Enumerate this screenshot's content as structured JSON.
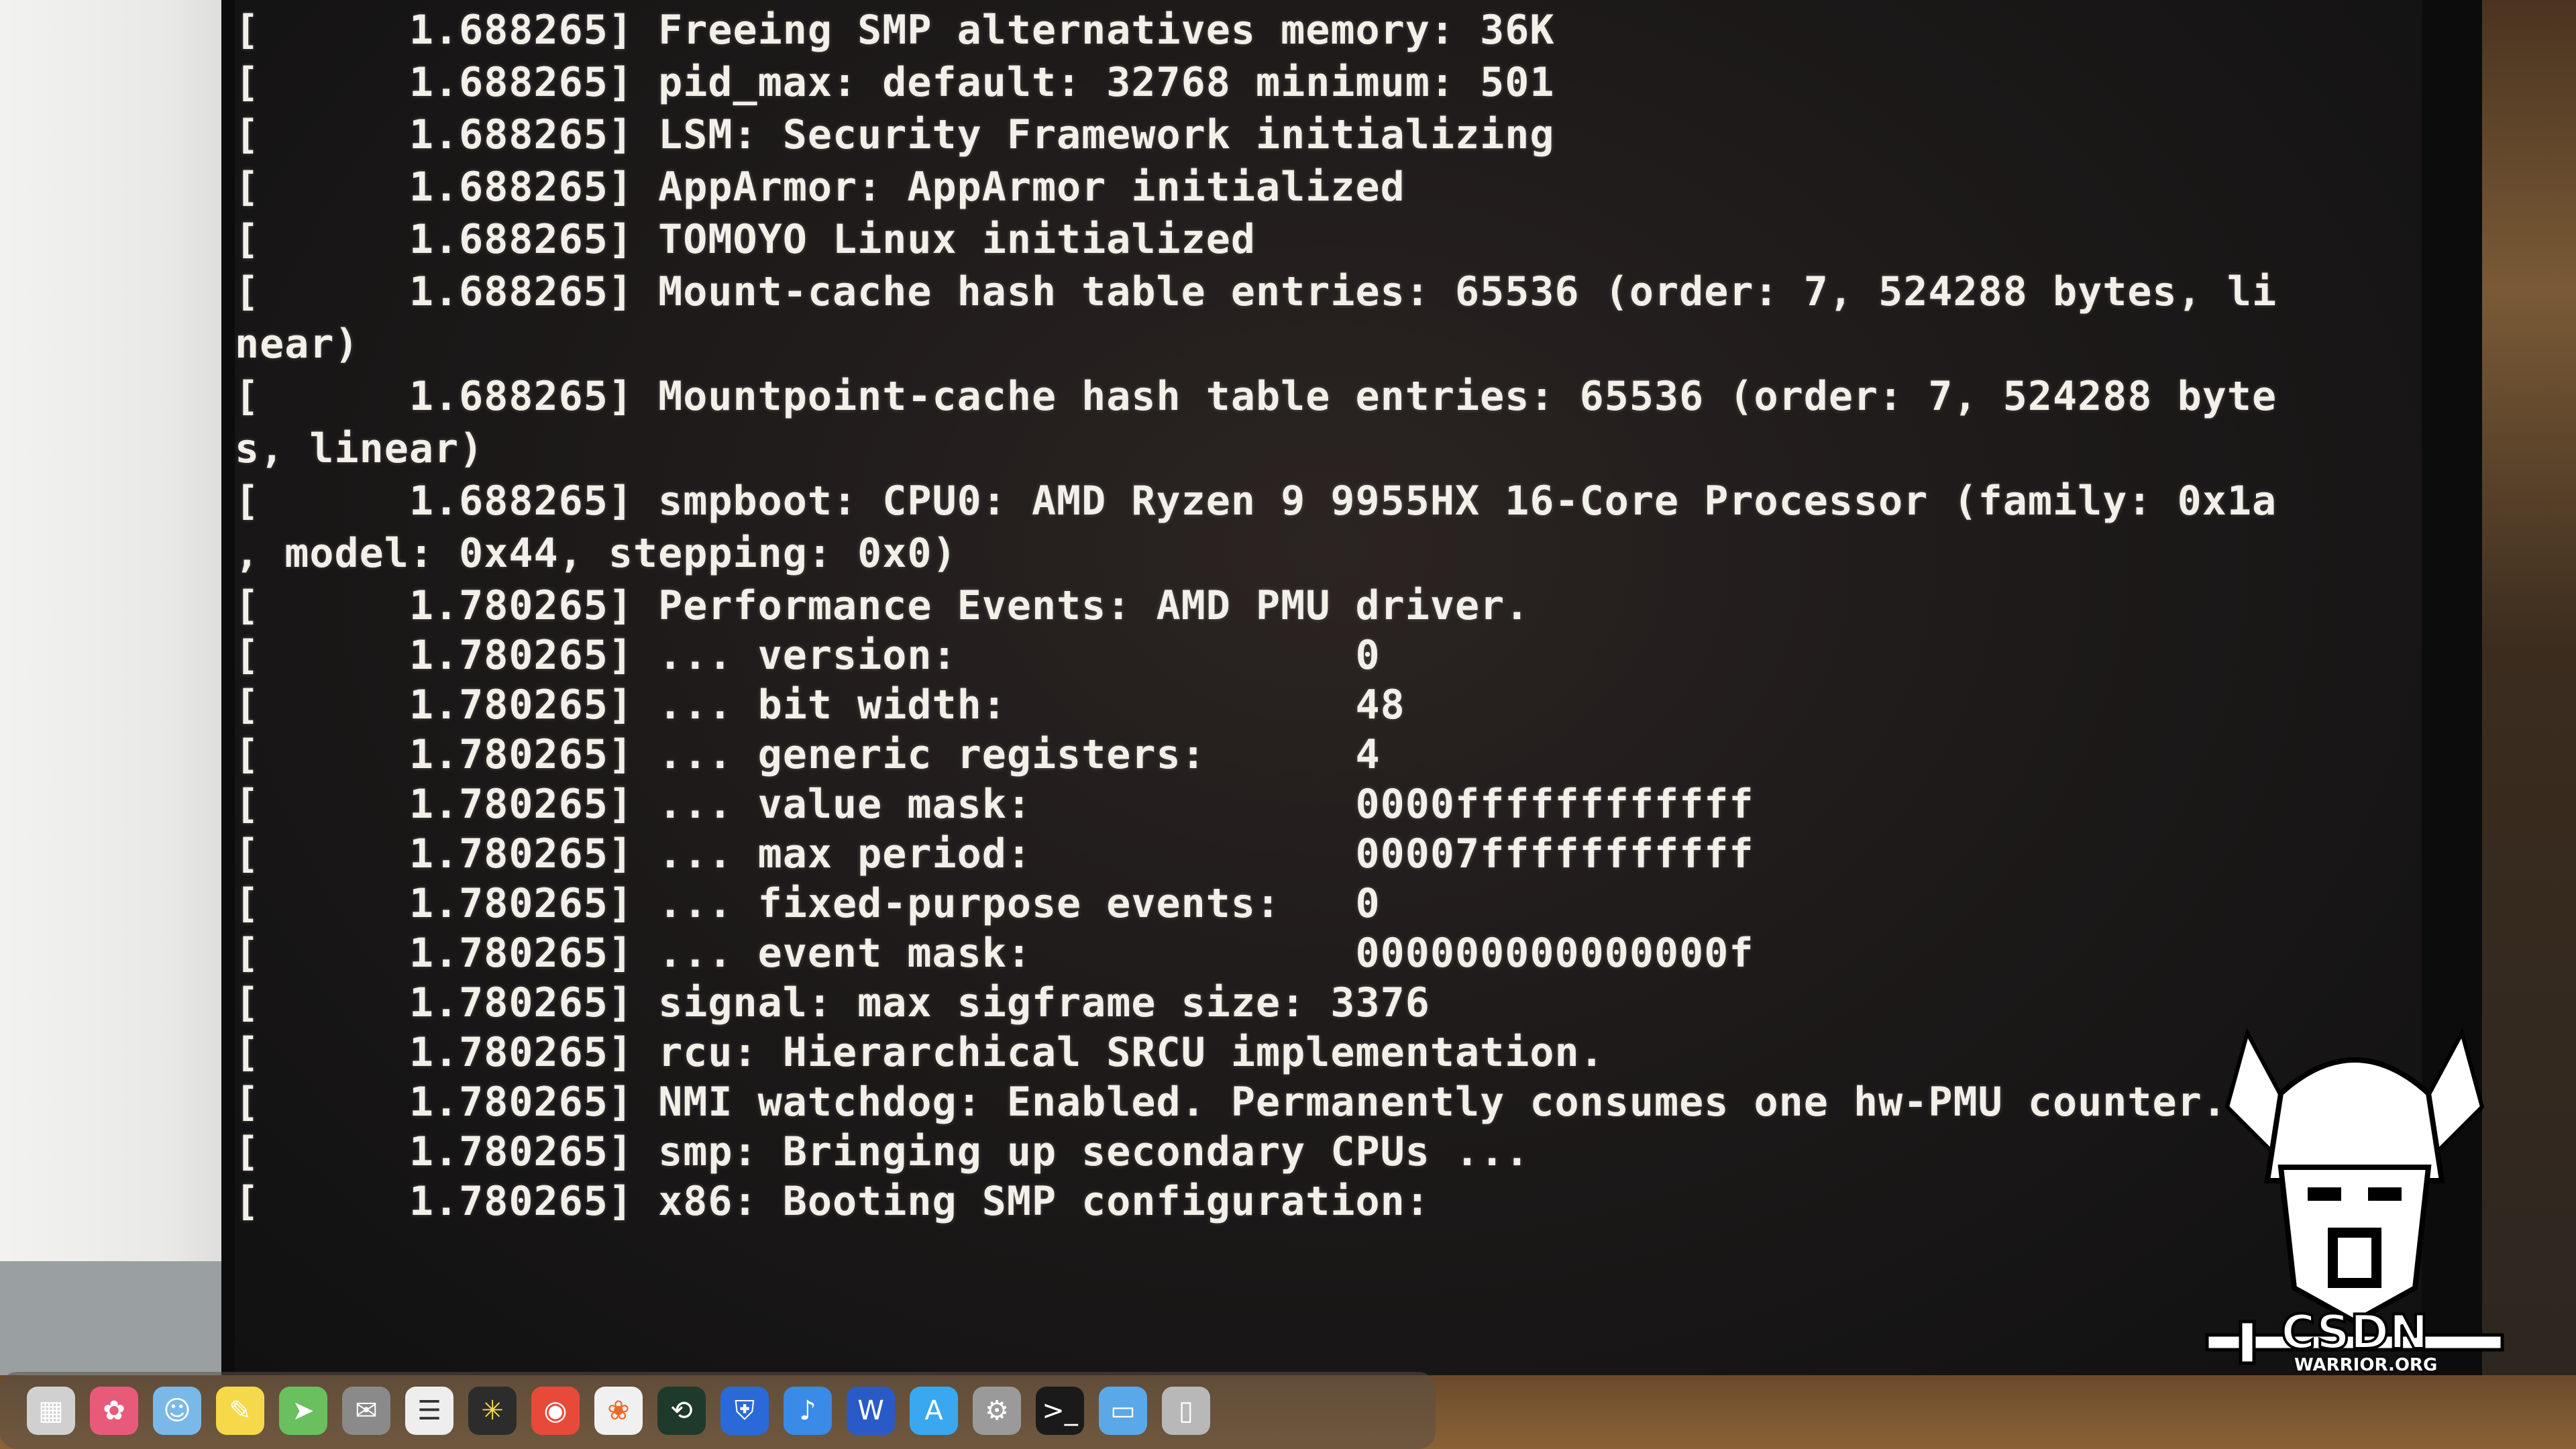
{
  "terminal": {
    "lines": [
      {
        "text": "[      1.688265] Freeing SMP alternatives memory: 36K"
      },
      {
        "text": "[      1.688265] pid_max: default: 32768 minimum: 501"
      },
      {
        "text": "[      1.688265] LSM: Security Framework initializing"
      },
      {
        "text": "[      1.688265] AppArmor: AppArmor initialized"
      },
      {
        "text": "[      1.688265] TOMOYO Linux initialized"
      },
      {
        "text": "[      1.688265] Mount-cache hash table entries: 65536 (order: 7, 524288 bytes, li"
      },
      {
        "text": "near)"
      },
      {
        "text": "[      1.688265] Mountpoint-cache hash table entries: 65536 (order: 7, 524288 byte"
      },
      {
        "text": "s, linear)"
      },
      {
        "text": "[      1.688265] smpboot: CPU0: AMD Ryzen 9 9955HX 16-Core Processor (family: 0x1a"
      },
      {
        "text": ", model: 0x44, stepping: 0x0)"
      },
      {
        "text": "[      1.780265] Performance Events: AMD PMU driver."
      },
      {
        "text": "[      1.780265] ... version:                0"
      },
      {
        "text": "[      1.780265] ... bit width:              48"
      },
      {
        "text": "[      1.780265] ... generic registers:      4"
      },
      {
        "text": "[      1.780265] ... value mask:             0000ffffffffffff"
      },
      {
        "text": "[      1.780265] ... max period:             00007fffffffffff"
      },
      {
        "text": "[      1.780265] ... fixed-purpose events:   0"
      },
      {
        "text": "[      1.780265] ... event mask:             000000000000000f"
      },
      {
        "text": "[      1.780265] signal: max sigframe size: 3376"
      },
      {
        "text": "[      1.780265] rcu: Hierarchical SRCU implementation."
      },
      {
        "text": "[      1.780265] NMI watchdog: Enabled. Permanently consumes one hw-PMU counter."
      },
      {
        "text": "[      1.780265] smp: Bringing up secondary CPUs ..."
      },
      {
        "text": "[      1.780265] x86: Booting SMP configuration:"
      }
    ]
  },
  "logo": {
    "caption": "WARRIOR.ORG",
    "wordmark": "CSDN"
  },
  "dock": {
    "icons": [
      "launchpad-icon",
      "photos-icon",
      "finder-icon",
      "notes-icon",
      "maps-icon",
      "mail-icon",
      "reminders-icon",
      "sun-icon",
      "chrome-icon",
      "photos-app-icon",
      "chatgpt-icon",
      "bitwarden-icon",
      "music-icon",
      "word-icon",
      "app-store-icon",
      "settings-icon",
      "terminal-icon",
      "folder-icon",
      "trash-icon"
    ]
  },
  "colors": {
    "terminal_text": "#f3f0ea",
    "terminal_bg": "#1b1818"
  }
}
